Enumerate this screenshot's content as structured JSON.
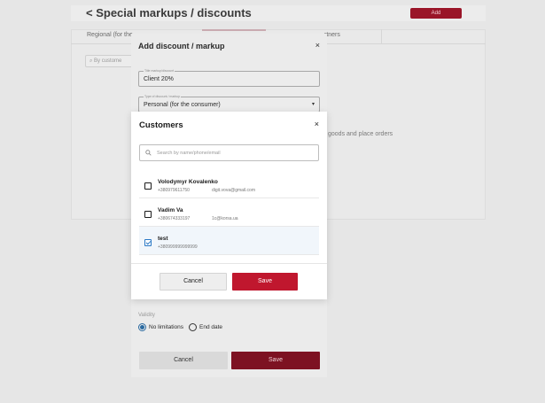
{
  "background": {
    "back_icon": "chevron-left-icon",
    "page_title": "Special markups / discounts",
    "add_button": "Add",
    "tabs": [
      "Regional (for the",
      "rtners"
    ],
    "search_placeholder": "By custome",
    "hint_text": "goods and place orders"
  },
  "discount_dialog": {
    "title": "Add discount / markup",
    "close_icon": "×",
    "name_field": {
      "label": "Title markup/discount",
      "value": "Client 20%"
    },
    "type_field": {
      "label": "Type of discount / markup",
      "value": "Personal (for the consumer)",
      "caret": "▾"
    },
    "validity_label": "Validity",
    "validity_options": [
      {
        "label": "No limitations",
        "selected": true
      },
      {
        "label": "End date",
        "selected": false
      }
    ],
    "cancel_label": "Cancel",
    "save_label": "Save"
  },
  "customers_dialog": {
    "title": "Customers",
    "close_icon": "×",
    "search_placeholder": "Search by name/phone/email",
    "customers": [
      {
        "name": "Volodymyr Kovalenko",
        "phone": "+380979611750",
        "email": "digit.vova@gmail.com",
        "checked": false
      },
      {
        "name": "Vadim Va",
        "phone": "+380674333197",
        "email": "1c@korsa.ua",
        "checked": false
      },
      {
        "name": "test",
        "phone": "+380999999999999",
        "email": "",
        "checked": true
      }
    ],
    "cancel_label": "Cancel",
    "save_label": "Save"
  },
  "colors": {
    "accent": "#c0172e",
    "checkbox_checked": "#2a78c5",
    "selected_row": "#f1f6fb"
  }
}
